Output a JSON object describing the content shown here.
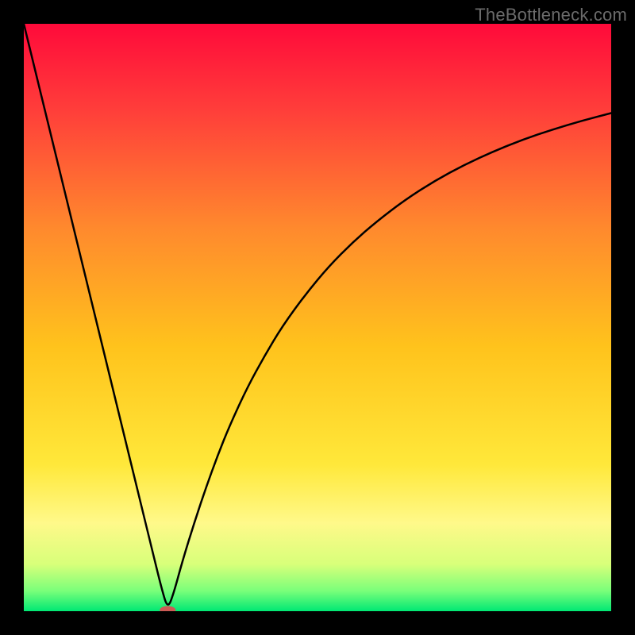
{
  "watermark": "TheBottleneck.com",
  "chart_data": {
    "type": "line",
    "title": "",
    "xlabel": "",
    "ylabel": "",
    "xlim": [
      0,
      100
    ],
    "ylim": [
      0,
      100
    ],
    "grid": false,
    "legend": false,
    "background_gradient": {
      "stops": [
        {
          "pos": 0.0,
          "color": "#ff0a3a"
        },
        {
          "pos": 0.15,
          "color": "#ff3f3a"
        },
        {
          "pos": 0.35,
          "color": "#ff8a2d"
        },
        {
          "pos": 0.55,
          "color": "#ffc31c"
        },
        {
          "pos": 0.75,
          "color": "#ffe83a"
        },
        {
          "pos": 0.85,
          "color": "#fff98a"
        },
        {
          "pos": 0.92,
          "color": "#d8ff7a"
        },
        {
          "pos": 0.965,
          "color": "#7bff7a"
        },
        {
          "pos": 1.0,
          "color": "#00e874"
        }
      ]
    },
    "series": [
      {
        "name": "bottleneck-curve",
        "color": "#000000",
        "stroke_width": 2.5,
        "x": [
          0,
          2,
          4,
          6,
          8,
          10,
          12,
          14,
          16,
          18,
          20,
          22,
          23.5,
          24.5,
          25.5,
          27,
          29,
          31,
          33,
          35,
          38,
          41,
          44,
          48,
          52,
          56,
          60,
          65,
          70,
          75,
          80,
          85,
          90,
          95,
          100
        ],
        "y": [
          100,
          91.8,
          83.6,
          75.4,
          67.2,
          59.0,
          50.8,
          42.6,
          34.4,
          26.2,
          18.0,
          9.8,
          3.7,
          0.4,
          3.0,
          8.5,
          15.0,
          21.0,
          26.5,
          31.5,
          38.0,
          43.5,
          48.5,
          54.0,
          58.8,
          62.8,
          66.3,
          70.1,
          73.3,
          76.0,
          78.3,
          80.3,
          82.0,
          83.5,
          84.8
        ]
      }
    ],
    "marker": {
      "name": "optimal-point",
      "x": 24.5,
      "y": 0.2,
      "color": "#cc5a55",
      "rx": 10,
      "ry": 5
    }
  }
}
